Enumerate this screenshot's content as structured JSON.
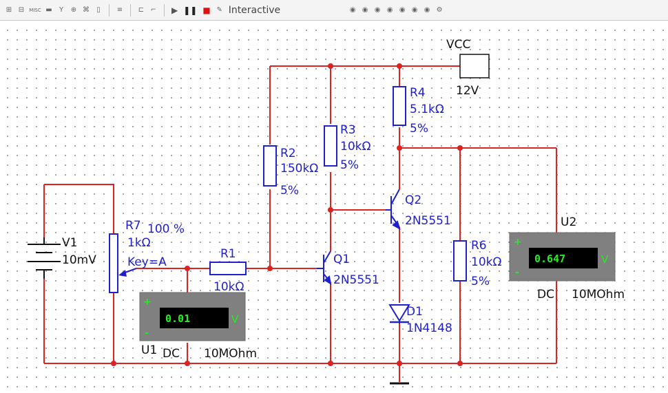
{
  "toolbar": {
    "icons": [
      "misc-label",
      "stop-icon"
    ],
    "misc_label": "MISC",
    "interactive_label": "Interactive",
    "colors": {
      "run": "#555555",
      "pause": "#333333",
      "stop": "#dd1111"
    }
  },
  "schematic": {
    "vcc": {
      "label": "VCC",
      "voltage": "12V"
    },
    "v1": {
      "name": "V1",
      "value": "10mV"
    },
    "r7": {
      "name": "R7",
      "percent": "100 %",
      "value": "1kΩ",
      "key": "Key=A"
    },
    "r1": {
      "name": "R1",
      "value": "10kΩ"
    },
    "r2": {
      "name": "R2",
      "value": "150kΩ",
      "tol": "5%"
    },
    "r3": {
      "name": "R3",
      "value": "10kΩ",
      "tol": "5%"
    },
    "r4": {
      "name": "R4",
      "value": "5.1kΩ",
      "tol": "5%"
    },
    "r6": {
      "name": "R6",
      "value": "10kΩ",
      "tol": "5%"
    },
    "q1": {
      "name": "Q1",
      "model": "2N5551"
    },
    "q2": {
      "name": "Q2",
      "model": "2N5551"
    },
    "d1": {
      "name": "D1",
      "model": "1N4148"
    },
    "u1": {
      "name": "U1",
      "reading": "0.01",
      "unit": "V",
      "mode": "DC",
      "resistance": "10MOhm",
      "plus": "+",
      "minus": "-"
    },
    "u2": {
      "name": "U2",
      "reading": "0.647",
      "unit": "V",
      "mode": "DC",
      "resistance": "10MOhm",
      "plus": "+",
      "minus": "-"
    },
    "colors": {
      "wire": "#dd2222",
      "component": "#1f1fcc",
      "meter_body": "#808080",
      "meter_display": "#000000",
      "meter_text": "#22ee22"
    }
  }
}
